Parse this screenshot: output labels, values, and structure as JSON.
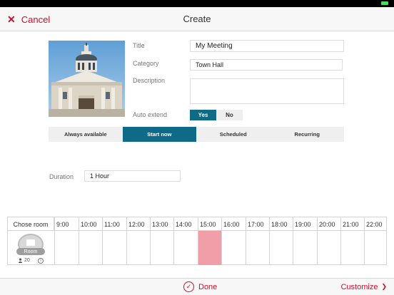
{
  "nav": {
    "cancel_label": "Cancel",
    "title": "Create"
  },
  "form": {
    "title_label": "Title",
    "title_value": "My Meeting",
    "category_label": "Category",
    "category_value": "Town Hall",
    "description_label": "Description",
    "description_value": "",
    "auto_extend_label": "Auto extend",
    "auto_extend_yes": "Yes",
    "auto_extend_no": "No",
    "auto_extend_selected": "Yes"
  },
  "modes": {
    "items": [
      "Always available",
      "Start now",
      "Scheduled",
      "Recurring"
    ],
    "selected": "Start now"
  },
  "duration": {
    "label": "Duration",
    "value": "1 Hour"
  },
  "timeline": {
    "room_header": "Chose room",
    "hours": [
      "9:00",
      "10:00",
      "11:00",
      "12:00",
      "13:00",
      "14:00",
      "15:00",
      "16:00",
      "17:00",
      "18:00",
      "19:00",
      "20:00",
      "21:00",
      "22:00"
    ],
    "selected_hour": "15:00",
    "room": {
      "name": "Room",
      "capacity": "20"
    }
  },
  "bottom": {
    "done_label": "Done",
    "customize_label": "Customize"
  },
  "colors": {
    "accent": "#c8102e",
    "primary": "#0e6a87",
    "selection": "#f09ea7"
  }
}
